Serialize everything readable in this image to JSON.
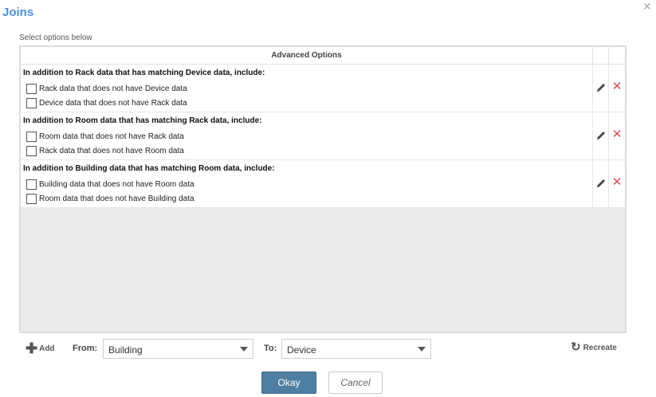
{
  "dialog": {
    "title": "Joins",
    "subtitle": "Select options below",
    "close_icon": "close-icon"
  },
  "grid": {
    "header": "Advanced Options",
    "rows": [
      {
        "heading": "In addition to Rack data that has matching Device data, include:",
        "options": [
          {
            "label": "Rack data that does not have Device data",
            "checked": false
          },
          {
            "label": "Device data that does not have Rack data",
            "checked": false
          }
        ]
      },
      {
        "heading": "In addition to Room data that has matching Rack data, include:",
        "options": [
          {
            "label": "Room data that does not have Rack data",
            "checked": false
          },
          {
            "label": "Rack data that does not have Room data",
            "checked": false
          }
        ]
      },
      {
        "heading": "In addition to Building data that has matching Room data, include:",
        "options": [
          {
            "label": "Building data that does not have Room data",
            "checked": false
          },
          {
            "label": "Room data that does not have Building data",
            "checked": false
          }
        ]
      }
    ]
  },
  "footer": {
    "add_label": "Add",
    "from_label": "From:",
    "from_value": "Building",
    "to_label": "To:",
    "to_value": "Device",
    "recreate_label": "Recreate",
    "okay_label": "Okay",
    "cancel_label": "Cancel"
  },
  "colors": {
    "title": "#4a90d9",
    "okay_bg": "#4f7fa0",
    "delete_red": "#d9534f"
  }
}
